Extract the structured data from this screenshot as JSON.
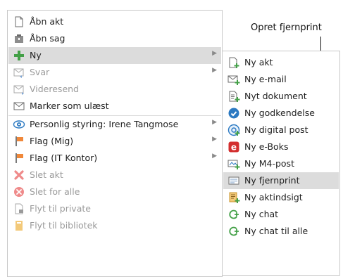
{
  "callout": {
    "text": "Opret fjernprint"
  },
  "main_menu": {
    "items": [
      {
        "label": "Åbn akt",
        "icon": "document-icon",
        "disabled": false,
        "has_submenu": false,
        "highlighted": false
      },
      {
        "label": "Åbn sag",
        "icon": "case-folder-icon",
        "disabled": false,
        "has_submenu": false,
        "highlighted": false
      },
      {
        "label": "Ny",
        "icon": "plus-icon",
        "disabled": false,
        "has_submenu": true,
        "highlighted": true
      },
      {
        "label": "Svar",
        "icon": "reply-mail-icon",
        "disabled": true,
        "has_submenu": true,
        "highlighted": false
      },
      {
        "label": "Videresend",
        "icon": "forward-mail-icon",
        "disabled": true,
        "has_submenu": false,
        "highlighted": false
      },
      {
        "label": "Marker som ulæst",
        "icon": "envelope-icon",
        "disabled": false,
        "has_submenu": false,
        "highlighted": false
      },
      {
        "label": "Personlig styring: Irene Tangmose",
        "icon": "eye-icon",
        "disabled": false,
        "has_submenu": true,
        "highlighted": false
      },
      {
        "label": "Flag (Mig)",
        "icon": "flag-icon",
        "disabled": false,
        "has_submenu": true,
        "highlighted": false
      },
      {
        "label": "Flag (IT Kontor)",
        "icon": "flag-icon",
        "disabled": false,
        "has_submenu": true,
        "highlighted": false
      },
      {
        "label": "Slet akt",
        "icon": "delete-x-icon",
        "disabled": true,
        "has_submenu": false,
        "highlighted": false
      },
      {
        "label": "Slet for alle",
        "icon": "delete-circle-icon",
        "disabled": true,
        "has_submenu": false,
        "highlighted": false
      },
      {
        "label": "Flyt til private",
        "icon": "move-private-icon",
        "disabled": true,
        "has_submenu": false,
        "highlighted": false
      },
      {
        "label": "Flyt til bibliotek",
        "icon": "library-icon",
        "disabled": true,
        "has_submenu": false,
        "highlighted": false
      }
    ]
  },
  "sub_menu": {
    "items": [
      {
        "label": "Ny akt",
        "icon": "new-document-icon",
        "highlighted": false
      },
      {
        "label": "Ny e-mail",
        "icon": "new-email-icon",
        "highlighted": false
      },
      {
        "label": "Nyt dokument",
        "icon": "new-text-document-icon",
        "highlighted": false
      },
      {
        "label": "Ny godkendelse",
        "icon": "approval-check-icon",
        "highlighted": false
      },
      {
        "label": "Ny digital post",
        "icon": "digital-post-icon",
        "highlighted": false
      },
      {
        "label": "Ny e-Boks",
        "icon": "eboks-icon",
        "highlighted": false
      },
      {
        "label": "Ny M4-post",
        "icon": "m4-post-icon",
        "highlighted": false
      },
      {
        "label": "Ny fjernprint",
        "icon": "remote-print-icon",
        "highlighted": true
      },
      {
        "label": "Ny aktindsigt",
        "icon": "access-request-icon",
        "highlighted": false
      },
      {
        "label": "Ny chat",
        "icon": "chat-icon",
        "highlighted": false
      },
      {
        "label": "Ny chat til alle",
        "icon": "chat-all-icon",
        "highlighted": false
      }
    ]
  },
  "colors": {
    "highlight": "#dcdcdc",
    "green": "#43a047",
    "flag_orange": "#f0883a",
    "delete_red": "#e57373",
    "eboks_red": "#d32f2f",
    "blue": "#2b79c2"
  }
}
